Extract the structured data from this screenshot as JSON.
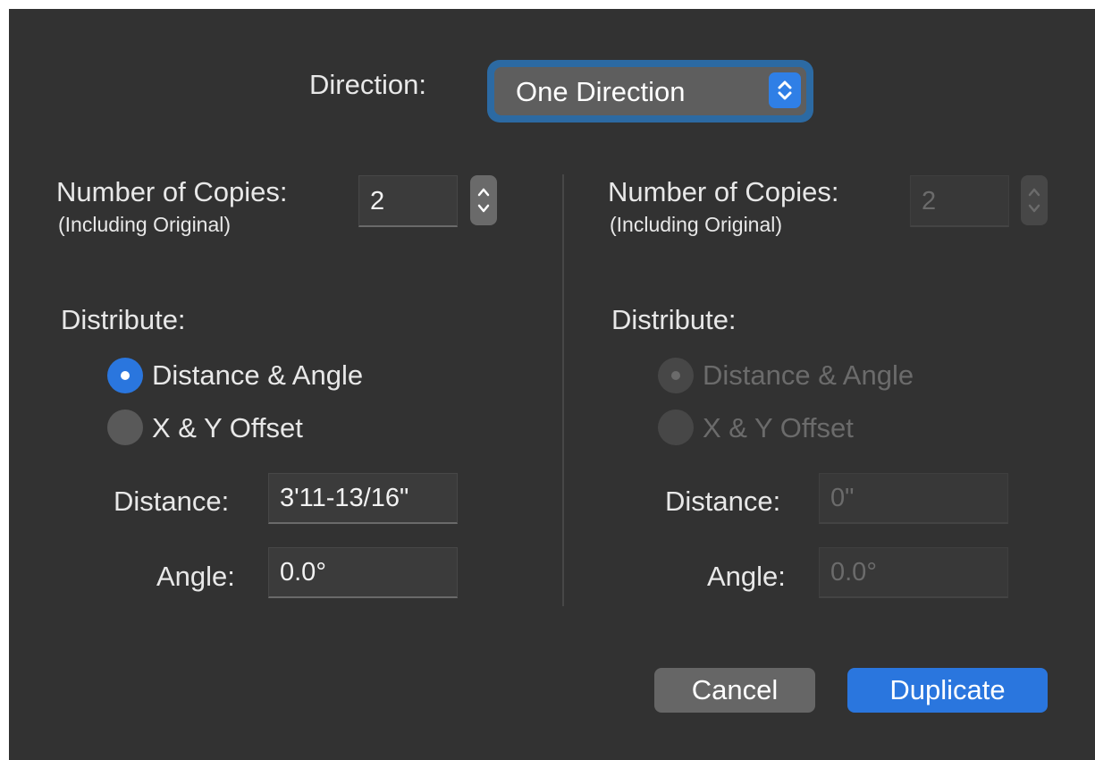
{
  "direction": {
    "label": "Direction:",
    "value": "One Direction"
  },
  "left": {
    "copies_label": "Number of Copies:",
    "copies_sub": "(Including Original)",
    "copies_value": "2",
    "distribute_label": "Distribute:",
    "options": [
      {
        "label": "Distance & Angle",
        "selected": true
      },
      {
        "label": "X & Y Offset",
        "selected": false
      }
    ],
    "distance_label": "Distance:",
    "distance_value": "3'11-13/16\"",
    "angle_label": "Angle:",
    "angle_value": "0.0°"
  },
  "right": {
    "copies_label": "Number of Copies:",
    "copies_sub": "(Including Original)",
    "copies_value": "2",
    "distribute_label": "Distribute:",
    "options": [
      {
        "label": "Distance & Angle",
        "selected": true
      },
      {
        "label": "X & Y Offset",
        "selected": false
      }
    ],
    "distance_label": "Distance:",
    "distance_value": "0\"",
    "angle_label": "Angle:",
    "angle_value": "0.0°",
    "enabled": false
  },
  "buttons": {
    "cancel": "Cancel",
    "confirm": "Duplicate"
  },
  "colors": {
    "dialog_bg": "#323232",
    "accent": "#2a76de",
    "disabled_text": "#6b6b6b"
  }
}
